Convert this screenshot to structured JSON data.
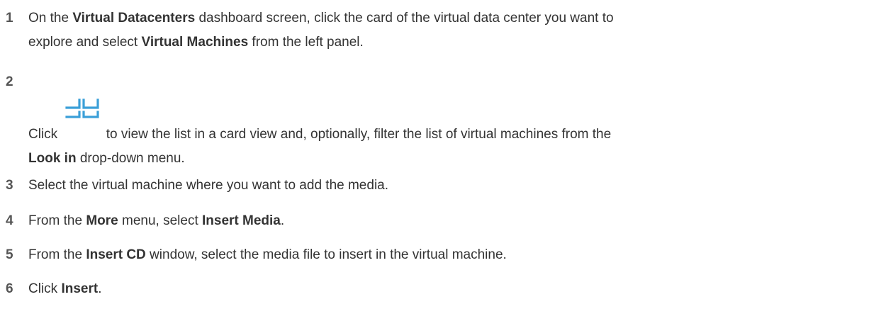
{
  "steps": [
    {
      "number": "1",
      "line1_a": "On the ",
      "line1_b": "Virtual Datacenters",
      "line1_c": " dashboard screen, click the card of the virtual data center you want to",
      "line2_a": "explore and select ",
      "line2_b": "Virtual Machines",
      "line2_c": " from the left panel."
    },
    {
      "number": "2",
      "line1_a": "Click ",
      "icon": "card-view-icon",
      "line1_b": " to view the list in a card view and, optionally, filter the list of virtual machines from the",
      "line2_a": "Look in",
      "line2_b": " drop-down menu."
    },
    {
      "number": "3",
      "text": "Select the virtual machine where you want to add the media."
    },
    {
      "number": "4",
      "a": "From the ",
      "b": "More",
      "c": " menu, select ",
      "d": "Insert Media",
      "e": "."
    },
    {
      "number": "5",
      "a": "From the ",
      "b": "Insert CD",
      "c": " window, select the media file to insert in the virtual machine."
    },
    {
      "number": "6",
      "a": "Click ",
      "b": "Insert",
      "c": "."
    }
  ],
  "colors": {
    "text": "#333333",
    "number": "#555555",
    "icon": "#3a9fd8"
  }
}
